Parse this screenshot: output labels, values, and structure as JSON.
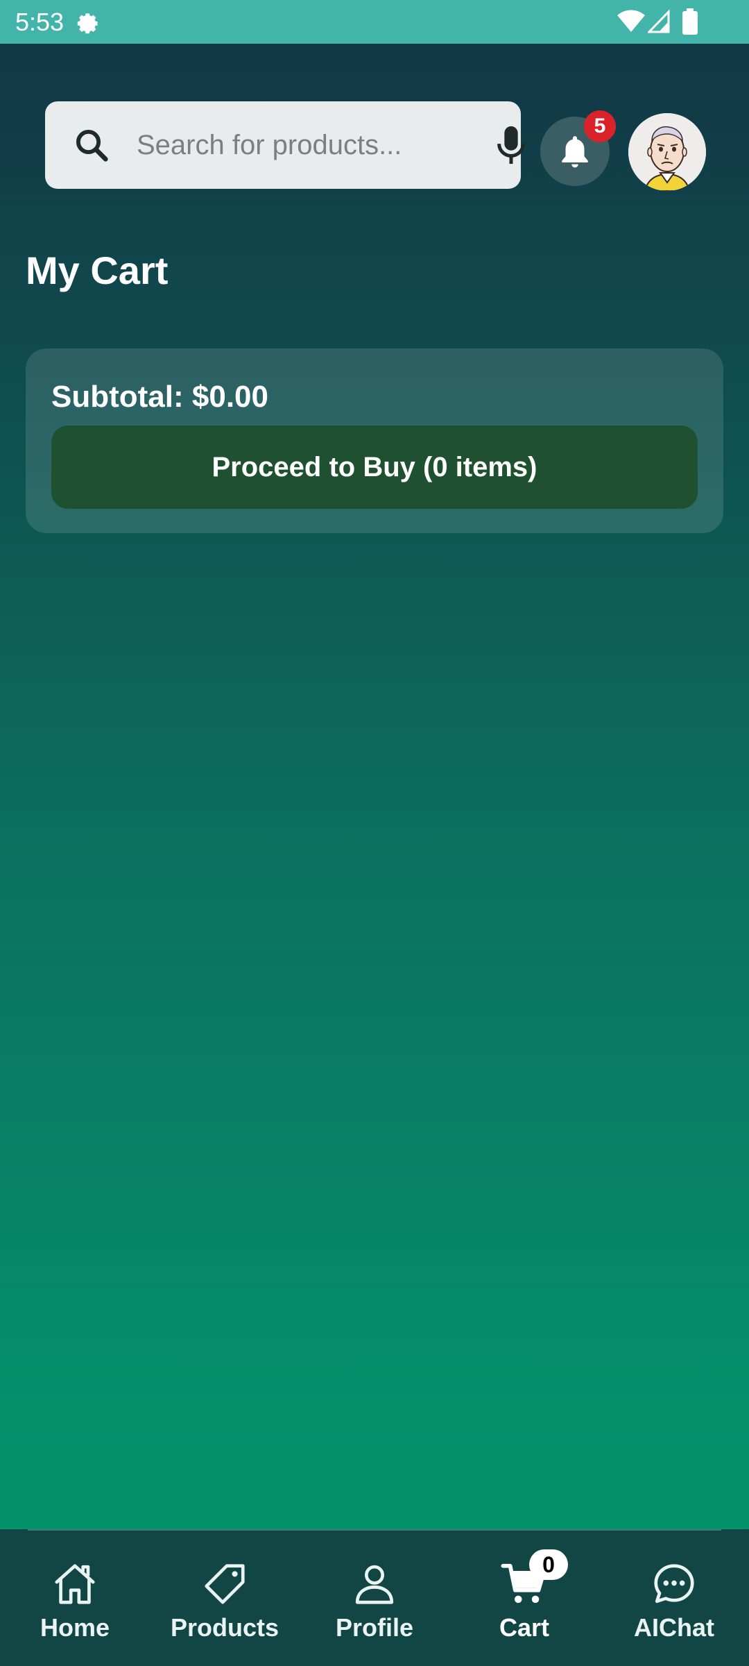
{
  "status_bar": {
    "time": "5:53",
    "icons": [
      "settings-gear-icon",
      "wifi-icon",
      "cell-signal-icon",
      "battery-icon"
    ]
  },
  "header": {
    "search": {
      "placeholder": "Search for products...",
      "icon": "search-icon",
      "voice_icon": "mic-icon"
    },
    "notifications": {
      "icon": "bell-icon",
      "count": "5"
    },
    "avatar": {
      "icon": "user-avatar-cartoon"
    }
  },
  "page": {
    "title": "My Cart"
  },
  "cart_summary": {
    "subtotal_label": "Subtotal:",
    "subtotal_value": "$0.00",
    "proceed_label": "Proceed to Buy (0 items)"
  },
  "bottom_nav": {
    "items": [
      {
        "label": "Home",
        "icon": "home-icon"
      },
      {
        "label": "Products",
        "icon": "tag-icon"
      },
      {
        "label": "Profile",
        "icon": "person-icon"
      },
      {
        "label": "Cart",
        "icon": "cart-icon",
        "active": true
      },
      {
        "label": "AIChat",
        "icon": "chat-bubble-icon"
      }
    ],
    "cart_count": "0"
  },
  "colors": {
    "status_bar": "#42b4aa",
    "background_top": "#123443",
    "background_bottom": "#00966a",
    "proceed_button": "#1f5130",
    "notification_badge": "#d9222a"
  }
}
